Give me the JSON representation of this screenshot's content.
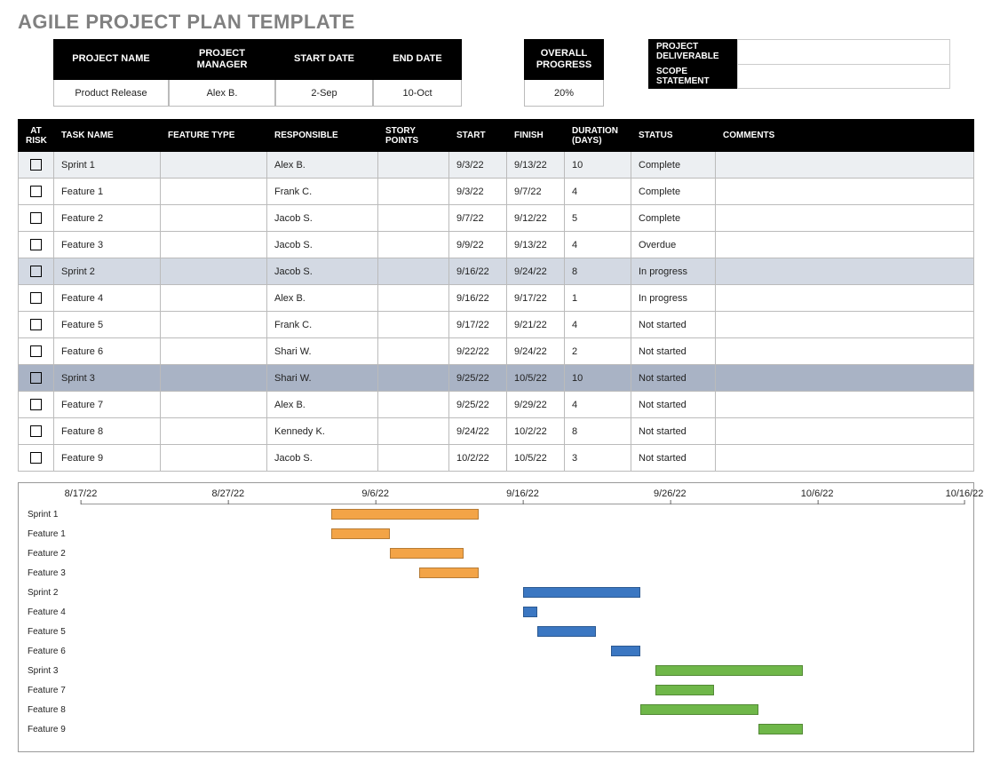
{
  "title": "AGILE PROJECT PLAN TEMPLATE",
  "summary": {
    "headers": {
      "project_name": "PROJECT NAME",
      "project_manager": "PROJECT MANAGER",
      "start_date": "START DATE",
      "end_date": "END DATE",
      "overall_progress": "OVERALL PROGRESS",
      "project_deliverable": "PROJECT DELIVERABLE",
      "scope_statement": "SCOPE STATEMENT"
    },
    "values": {
      "project_name": "Product Release",
      "project_manager": "Alex B.",
      "start_date": "2-Sep",
      "end_date": "10-Oct",
      "overall_progress": "20%",
      "project_deliverable": "",
      "scope_statement": ""
    }
  },
  "table": {
    "columns": {
      "at_risk": "AT RISK",
      "task_name": "TASK NAME",
      "feature_type": "FEATURE TYPE",
      "responsible": "RESPONSIBLE",
      "story_points": "STORY POINTS",
      "start": "START",
      "finish": "FINISH",
      "duration": "DURATION (DAYS)",
      "status": "STATUS",
      "comments": "COMMENTS"
    },
    "rows": [
      {
        "task": "Sprint 1",
        "feature": "",
        "resp": "Alex B.",
        "story": "",
        "start": "9/3/22",
        "finish": "9/13/22",
        "dur": "10",
        "status": "Complete",
        "shade": "light"
      },
      {
        "task": "Feature 1",
        "feature": "",
        "resp": "Frank C.",
        "story": "",
        "start": "9/3/22",
        "finish": "9/7/22",
        "dur": "4",
        "status": "Complete",
        "shade": ""
      },
      {
        "task": "Feature 2",
        "feature": "",
        "resp": "Jacob S.",
        "story": "",
        "start": "9/7/22",
        "finish": "9/12/22",
        "dur": "5",
        "status": "Complete",
        "shade": ""
      },
      {
        "task": "Feature 3",
        "feature": "",
        "resp": "Jacob S.",
        "story": "",
        "start": "9/9/22",
        "finish": "9/13/22",
        "dur": "4",
        "status": "Overdue",
        "shade": ""
      },
      {
        "task": "Sprint 2",
        "feature": "",
        "resp": "Jacob S.",
        "story": "",
        "start": "9/16/22",
        "finish": "9/24/22",
        "dur": "8",
        "status": "In progress",
        "shade": "med"
      },
      {
        "task": "Feature 4",
        "feature": "",
        "resp": "Alex B.",
        "story": "",
        "start": "9/16/22",
        "finish": "9/17/22",
        "dur": "1",
        "status": "In progress",
        "shade": ""
      },
      {
        "task": "Feature 5",
        "feature": "",
        "resp": "Frank C.",
        "story": "",
        "start": "9/17/22",
        "finish": "9/21/22",
        "dur": "4",
        "status": "Not started",
        "shade": ""
      },
      {
        "task": "Feature 6",
        "feature": "",
        "resp": "Shari W.",
        "story": "",
        "start": "9/22/22",
        "finish": "9/24/22",
        "dur": "2",
        "status": "Not started",
        "shade": ""
      },
      {
        "task": "Sprint 3",
        "feature": "",
        "resp": "Shari W.",
        "story": "",
        "start": "9/25/22",
        "finish": "10/5/22",
        "dur": "10",
        "status": "Not started",
        "shade": "dark"
      },
      {
        "task": "Feature 7",
        "feature": "",
        "resp": "Alex B.",
        "story": "",
        "start": "9/25/22",
        "finish": "9/29/22",
        "dur": "4",
        "status": "Not started",
        "shade": ""
      },
      {
        "task": "Feature 8",
        "feature": "",
        "resp": "Kennedy K.",
        "story": "",
        "start": "9/24/22",
        "finish": "10/2/22",
        "dur": "8",
        "status": "Not started",
        "shade": ""
      },
      {
        "task": "Feature 9",
        "feature": "",
        "resp": "Jacob S.",
        "story": "",
        "start": "10/2/22",
        "finish": "10/5/22",
        "dur": "3",
        "status": "Not started",
        "shade": ""
      }
    ]
  },
  "chart_data": {
    "type": "gantt",
    "x_axis": {
      "min": "8/17/22",
      "max": "10/16/22",
      "ticks": [
        "8/17/22",
        "8/27/22",
        "9/6/22",
        "9/16/22",
        "9/26/22",
        "10/6/22",
        "10/16/22"
      ]
    },
    "series_colors": {
      "sprint1": "#f3a447",
      "sprint2": "#3b77c2",
      "sprint3": "#6fb749"
    },
    "bars": [
      {
        "label": "Sprint 1",
        "start": "9/3/22",
        "end": "9/13/22",
        "group": "sprint1"
      },
      {
        "label": "Feature 1",
        "start": "9/3/22",
        "end": "9/7/22",
        "group": "sprint1"
      },
      {
        "label": "Feature 2",
        "start": "9/7/22",
        "end": "9/12/22",
        "group": "sprint1"
      },
      {
        "label": "Feature 3",
        "start": "9/9/22",
        "end": "9/13/22",
        "group": "sprint1"
      },
      {
        "label": "Sprint 2",
        "start": "9/16/22",
        "end": "9/24/22",
        "group": "sprint2"
      },
      {
        "label": "Feature 4",
        "start": "9/16/22",
        "end": "9/17/22",
        "group": "sprint2"
      },
      {
        "label": "Feature 5",
        "start": "9/17/22",
        "end": "9/21/22",
        "group": "sprint2"
      },
      {
        "label": "Feature 6",
        "start": "9/22/22",
        "end": "9/24/22",
        "group": "sprint2"
      },
      {
        "label": "Sprint 3",
        "start": "9/25/22",
        "end": "10/5/22",
        "group": "sprint3"
      },
      {
        "label": "Feature 7",
        "start": "9/25/22",
        "end": "9/29/22",
        "group": "sprint3"
      },
      {
        "label": "Feature 8",
        "start": "9/24/22",
        "end": "10/2/22",
        "group": "sprint3"
      },
      {
        "label": "Feature 9",
        "start": "10/2/22",
        "end": "10/5/22",
        "group": "sprint3"
      }
    ]
  }
}
